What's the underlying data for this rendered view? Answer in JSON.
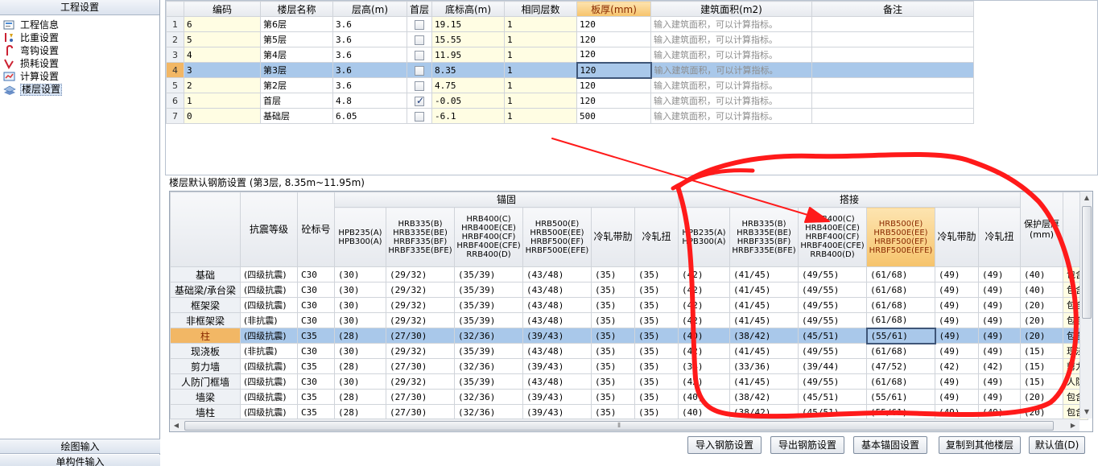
{
  "left_panel": {
    "title": "工程设置",
    "items": [
      {
        "label": "工程信息",
        "icon": "info-icon"
      },
      {
        "label": "比重设置",
        "icon": "weight-icon"
      },
      {
        "label": "弯钩设置",
        "icon": "hook-icon"
      },
      {
        "label": "损耗设置",
        "icon": "loss-icon"
      },
      {
        "label": "计算设置",
        "icon": "calc-icon"
      },
      {
        "label": "楼层设置",
        "icon": "floor-icon"
      }
    ],
    "bottom_tab_1": "绘图输入",
    "bottom_tab_2": "单构件输入"
  },
  "floor_table": {
    "headers": [
      "编码",
      "楼层名称",
      "层高(m)",
      "首层",
      "底标高(m)",
      "相同层数",
      "板厚(mm)",
      "建筑面积(m2)",
      "备注"
    ],
    "rows": [
      {
        "rn": "1",
        "code": "6",
        "name": "第6层",
        "height": "3.6",
        "first": false,
        "bottom": "19.15",
        "same": "1",
        "slab": "120",
        "area": "输入建筑面积，可以计算指标。"
      },
      {
        "rn": "2",
        "code": "5",
        "name": "第5层",
        "height": "3.6",
        "first": false,
        "bottom": "15.55",
        "same": "1",
        "slab": "120",
        "area": "输入建筑面积，可以计算指标。"
      },
      {
        "rn": "3",
        "code": "4",
        "name": "第4层",
        "height": "3.6",
        "first": false,
        "bottom": "11.95",
        "same": "1",
        "slab": "120",
        "area": "输入建筑面积，可以计算指标。"
      },
      {
        "rn": "4",
        "code": "3",
        "name": "第3层",
        "height": "3.6",
        "first": false,
        "bottom": "8.35",
        "same": "1",
        "slab": "120",
        "area": "输入建筑面积，可以计算指标。"
      },
      {
        "rn": "5",
        "code": "2",
        "name": "第2层",
        "height": "3.6",
        "first": false,
        "bottom": "4.75",
        "same": "1",
        "slab": "120",
        "area": "输入建筑面积，可以计算指标。"
      },
      {
        "rn": "6",
        "code": "1",
        "name": "首层",
        "height": "4.8",
        "first": true,
        "bottom": "-0.05",
        "same": "1",
        "slab": "120",
        "area": "输入建筑面积，可以计算指标。"
      },
      {
        "rn": "7",
        "code": "0",
        "name": "基础层",
        "height": "6.05",
        "first": false,
        "bottom": "-6.1",
        "same": "1",
        "slab": "500",
        "area": "输入建筑面积，可以计算指标。"
      }
    ]
  },
  "rebar_section_label": "楼层默认钢筋设置 (第3层, 8.35m~11.95m)",
  "rebar_table": {
    "col_seismic": "抗震等级",
    "col_concrete": "砼标号",
    "group_anchor": "锚固",
    "group_lap": "搭接",
    "col_cover": "保护层厚\n(mm)",
    "sub_headers": [
      "HPB235(A)\nHPB300(A)",
      "HRB335(B)\nHRB335E(BE)\nHRBF335(BF)\nHRBF335E(BFE)",
      "HRB400(C)\nHRB400E(CE)\nHRBF400(CF)\nHRBF400E(CFE)\nRRB400(D)",
      "HRB500(E)\nHRB500E(EE)\nHRBF500(EF)\nHRBF500E(EFE)",
      "冷轧带肋",
      "冷轧扭"
    ],
    "rows": [
      {
        "name": "基础",
        "seismic": "(四级抗震)",
        "concrete": "C30",
        "anchor": [
          "(30)",
          "(29/32)",
          "(35/39)",
          "(43/48)",
          "(35)",
          "(35)"
        ],
        "lap": [
          "(42)",
          "(41/45)",
          "(49/55)",
          "(61/68)",
          "(49)",
          "(49)"
        ],
        "cover": "(40)",
        "extra": "包含"
      },
      {
        "name": "基础梁/承台梁",
        "seismic": "(四级抗震)",
        "concrete": "C30",
        "anchor": [
          "(30)",
          "(29/32)",
          "(35/39)",
          "(43/48)",
          "(35)",
          "(35)"
        ],
        "lap": [
          "(42)",
          "(41/45)",
          "(49/55)",
          "(61/68)",
          "(49)",
          "(49)"
        ],
        "cover": "(40)",
        "extra": "包含"
      },
      {
        "name": "框架梁",
        "seismic": "(四级抗震)",
        "concrete": "C30",
        "anchor": [
          "(30)",
          "(29/32)",
          "(35/39)",
          "(43/48)",
          "(35)",
          "(35)"
        ],
        "lap": [
          "(42)",
          "(41/45)",
          "(49/55)",
          "(61/68)",
          "(49)",
          "(49)"
        ],
        "cover": "(20)",
        "extra": "包含"
      },
      {
        "name": "非框架梁",
        "seismic": "(非抗震)",
        "concrete": "C30",
        "anchor": [
          "(30)",
          "(29/32)",
          "(35/39)",
          "(43/48)",
          "(35)",
          "(35)"
        ],
        "lap": [
          "(42)",
          "(41/45)",
          "(49/55)",
          "(61/68)",
          "(49)",
          "(49)"
        ],
        "cover": "(20)",
        "extra": "包含"
      },
      {
        "name": "柱",
        "seismic": "(四级抗震)",
        "concrete": "C35",
        "anchor": [
          "(28)",
          "(27/30)",
          "(32/36)",
          "(39/43)",
          "(35)",
          "(35)"
        ],
        "lap": [
          "(40)",
          "(38/42)",
          "(45/51)",
          "(55/61)",
          "(49)",
          "(49)"
        ],
        "cover": "(20)",
        "extra": "包含"
      },
      {
        "name": "现浇板",
        "seismic": "(非抗震)",
        "concrete": "C30",
        "anchor": [
          "(30)",
          "(29/32)",
          "(35/39)",
          "(43/48)",
          "(35)",
          "(35)"
        ],
        "lap": [
          "(42)",
          "(41/45)",
          "(49/55)",
          "(61/68)",
          "(49)",
          "(49)"
        ],
        "cover": "(15)",
        "extra": "现浇"
      },
      {
        "name": "剪力墙",
        "seismic": "(四级抗震)",
        "concrete": "C35",
        "anchor": [
          "(28)",
          "(27/30)",
          "(32/36)",
          "(39/43)",
          "(35)",
          "(35)"
        ],
        "lap": [
          "(34)",
          "(33/36)",
          "(39/44)",
          "(47/52)",
          "(42)",
          "(42)"
        ],
        "cover": "(15)",
        "extra": "剪力"
      },
      {
        "name": "人防门框墙",
        "seismic": "(四级抗震)",
        "concrete": "C30",
        "anchor": [
          "(30)",
          "(29/32)",
          "(35/39)",
          "(43/48)",
          "(35)",
          "(35)"
        ],
        "lap": [
          "(42)",
          "(41/45)",
          "(49/55)",
          "(61/68)",
          "(49)",
          "(49)"
        ],
        "cover": "(15)",
        "extra": "人防"
      },
      {
        "name": "墙梁",
        "seismic": "(四级抗震)",
        "concrete": "C35",
        "anchor": [
          "(28)",
          "(27/30)",
          "(32/36)",
          "(39/43)",
          "(35)",
          "(35)"
        ],
        "lap": [
          "(40)",
          "(38/42)",
          "(45/51)",
          "(55/61)",
          "(49)",
          "(49)"
        ],
        "cover": "(20)",
        "extra": "包含"
      },
      {
        "name": "墙柱",
        "seismic": "(四级抗震)",
        "concrete": "C35",
        "anchor": [
          "(28)",
          "(27/30)",
          "(32/36)",
          "(39/43)",
          "(35)",
          "(35)"
        ],
        "lap": [
          "(40)",
          "(38/42)",
          "(45/51)",
          "(55/61)",
          "(49)",
          "(49)"
        ],
        "cover": "(20)",
        "extra": "包含"
      }
    ]
  },
  "buttons": {
    "import": "导入钢筋设置",
    "export": "导出钢筋设置",
    "anchor": "基本锚固设置",
    "copy": "复制到其他楼层",
    "default": "默认值(D)"
  },
  "colors": {
    "selected_row": "#a9c8ea",
    "header_highlight": "#f6c36b",
    "editable_cell": "#fffde3",
    "annotation": "#ff1a1a"
  }
}
